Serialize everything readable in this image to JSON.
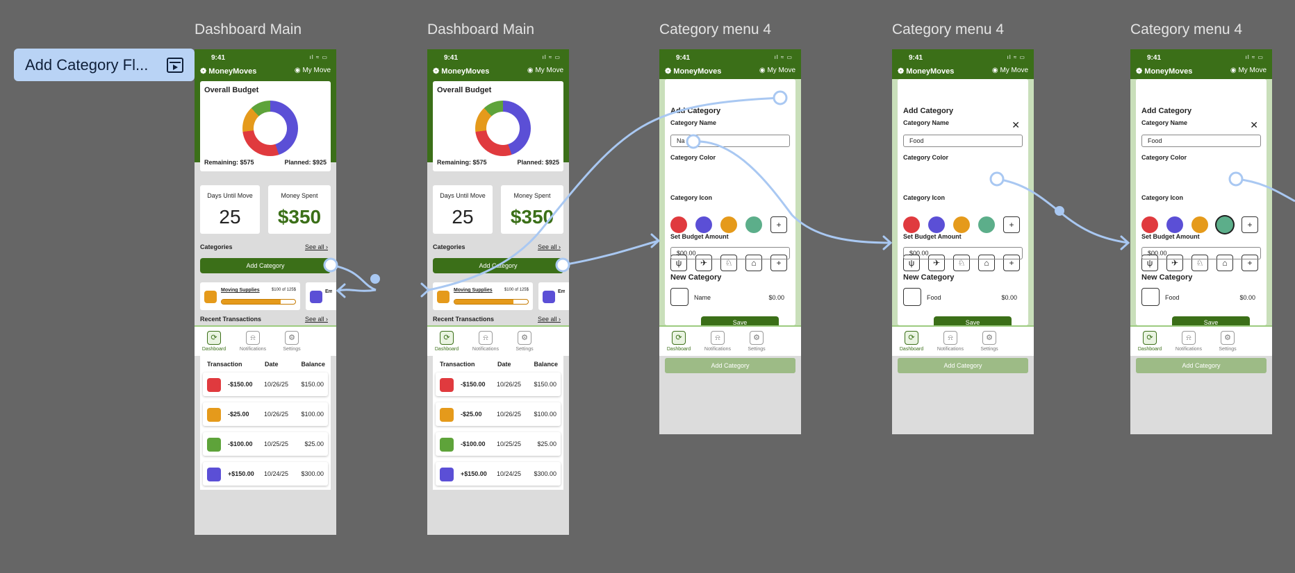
{
  "flow": {
    "title": "Add Category Fl..."
  },
  "frames": [
    {
      "label": "Dashboard Main"
    },
    {
      "label": "Dashboard Main"
    },
    {
      "label": "Category menu 4"
    },
    {
      "label": "Category menu 4"
    },
    {
      "label": "Category menu 4"
    }
  ],
  "status": {
    "time": "9:41",
    "icons": "ıl ≈ ▭"
  },
  "header": {
    "brand": "MoneyMoves",
    "user": "My Move"
  },
  "dashboard": {
    "overall_title": "Overall Budget",
    "remaining": "Remaining: $575",
    "planned": "Planned: $925",
    "donut_segments": [
      {
        "color": "#5b4fd6",
        "value": 45
      },
      {
        "color": "#e03a3e",
        "value": 28
      },
      {
        "color": "#e59a1b",
        "value": 15
      },
      {
        "color": "#5ea33a",
        "value": 12
      }
    ],
    "days_label": "Days Until Move",
    "days_value": "25",
    "spent_label": "Money Spent",
    "spent_value": "$350",
    "categories_label": "Categories",
    "see_all": "See all  ›",
    "add_category": "Add Category",
    "cat_item": {
      "name": "Moving Supplies",
      "amount": "$100 of 125$",
      "progress": 0.8
    },
    "cat_item2": {
      "name": "Em"
    },
    "recent_label": "Recent Transactions",
    "tx_headers": [
      "Transaction",
      "Date",
      "Balance"
    ],
    "transactions": [
      {
        "amount": "-$150.00",
        "date": "10/26/25",
        "balance": "$150.00",
        "color": "#e03a3e",
        "icon": "truck-icon"
      },
      {
        "amount": "-$25.00",
        "date": "10/26/25",
        "balance": "$100.00",
        "color": "#e59a1b",
        "icon": "box-icon"
      },
      {
        "amount": "-$100.00",
        "date": "10/25/25",
        "balance": "$25.00",
        "color": "#5ea33a",
        "icon": "home-icon"
      },
      {
        "amount": "+$150.00",
        "date": "10/24/25",
        "balance": "$300.00",
        "color": "#5b4fd6",
        "icon": "piggy-icon"
      }
    ]
  },
  "tabs": [
    "Dashboard",
    "Notifications",
    "Settings"
  ],
  "modal": {
    "title": "Add Category",
    "name_label": "Category Name",
    "color_label": "Category Color",
    "icon_label": "Category Icon",
    "budget_label": "Set Budget Amount",
    "budget_value": "$00.00",
    "new_category": "New Category",
    "save": "Save",
    "swatch_colors": [
      "#e03a3e",
      "#5b4fd6",
      "#e59a1b",
      "#5cae8a"
    ],
    "icons": [
      "utensils-icon",
      "plane-icon",
      "dog-icon",
      "bed-icon",
      "plus-icon"
    ],
    "price": "$0.00",
    "name_values": [
      "Na",
      "Food",
      "Food"
    ],
    "new_names": [
      "Name",
      "Food",
      "Food"
    ]
  },
  "bottom_add": "Add Category"
}
